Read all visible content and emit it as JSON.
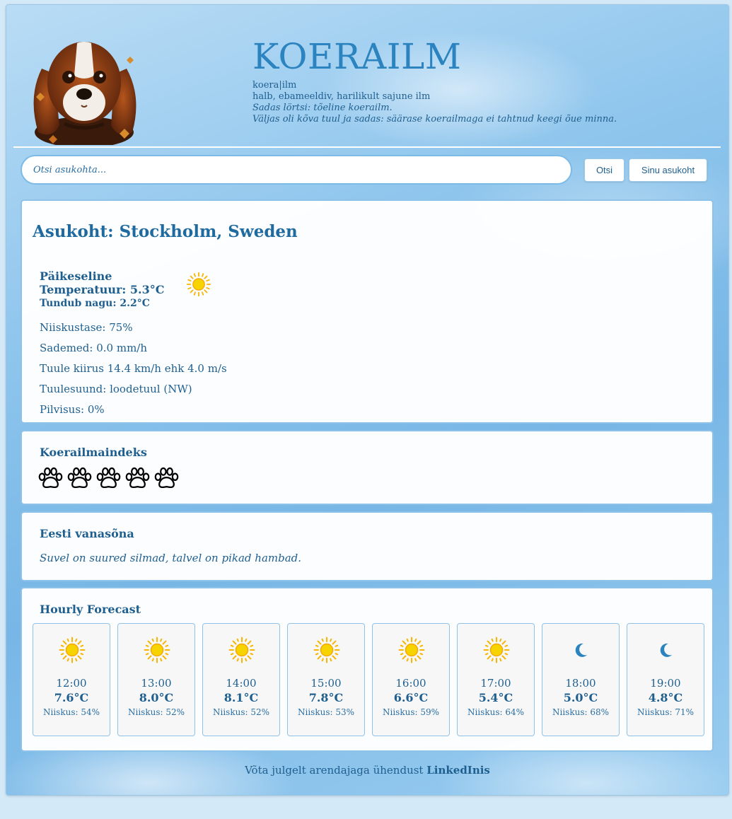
{
  "header": {
    "title": "KOERAILM",
    "definition": {
      "word": "koera|ilm",
      "meaning": "halb, ebameeldiv, harilikult sajune ilm",
      "example1": "Sadas lörtsi: tõeline koerailm.",
      "example2": "Väljas oli kõva tuul ja sadas: säärase koerailmaga ei tahtnud keegi õue minna."
    }
  },
  "search": {
    "placeholder": "Otsi asukohta...",
    "search_label": "Otsi",
    "location_label": "Sinu asukoht"
  },
  "current": {
    "location_title": "Asukoht: Stockholm, Sweden",
    "condition": "Päikeseline",
    "temperature": "Temperatuur: 5.3°C",
    "feels_like": "Tundub nagu: 2.2°C",
    "icon": "sun-icon",
    "humidity": "Niiskustase: 75%",
    "precipitation": "Sademed: 0.0 mm/h",
    "wind_speed": "Tuule kiirus 14.4 km/h ehk 4.0 m/s",
    "wind_direction": "Tuulesuund: loodetuul (NW)",
    "cloudiness": "Pilvisus: 0%"
  },
  "dog_index": {
    "heading": "Koerailmaindeks",
    "paws_total": 5,
    "paws_filled": 0
  },
  "proverb": {
    "heading": "Eesti vanasõna",
    "text": "Suvel on suured silmad, talvel on pikad hambad."
  },
  "hourly": {
    "heading": "Hourly Forecast",
    "items": [
      {
        "time": "12:00",
        "temp": "7.6°C",
        "humidity": "Niiskus: 54%",
        "icon": "sun-icon"
      },
      {
        "time": "13:00",
        "temp": "8.0°C",
        "humidity": "Niiskus: 52%",
        "icon": "sun-icon"
      },
      {
        "time": "14:00",
        "temp": "8.1°C",
        "humidity": "Niiskus: 52%",
        "icon": "sun-icon"
      },
      {
        "time": "15:00",
        "temp": "7.8°C",
        "humidity": "Niiskus: 53%",
        "icon": "sun-icon"
      },
      {
        "time": "16:00",
        "temp": "6.6°C",
        "humidity": "Niiskus: 59%",
        "icon": "sun-icon"
      },
      {
        "time": "17:00",
        "temp": "5.4°C",
        "humidity": "Niiskus: 64%",
        "icon": "sun-icon"
      },
      {
        "time": "18:00",
        "temp": "5.0°C",
        "humidity": "Niiskus: 68%",
        "icon": "moon-icon"
      },
      {
        "time": "19:00",
        "temp": "4.8°C",
        "humidity": "Niiskus: 71%",
        "icon": "moon-icon"
      }
    ]
  },
  "footer": {
    "text": "Võta julgelt arendajaga ühendust",
    "link": "LinkedInis"
  },
  "colors": {
    "accent": "#2b83c0",
    "text": "#1f5f8f",
    "sun": "#f7c700",
    "moon": "#2b83c0"
  }
}
